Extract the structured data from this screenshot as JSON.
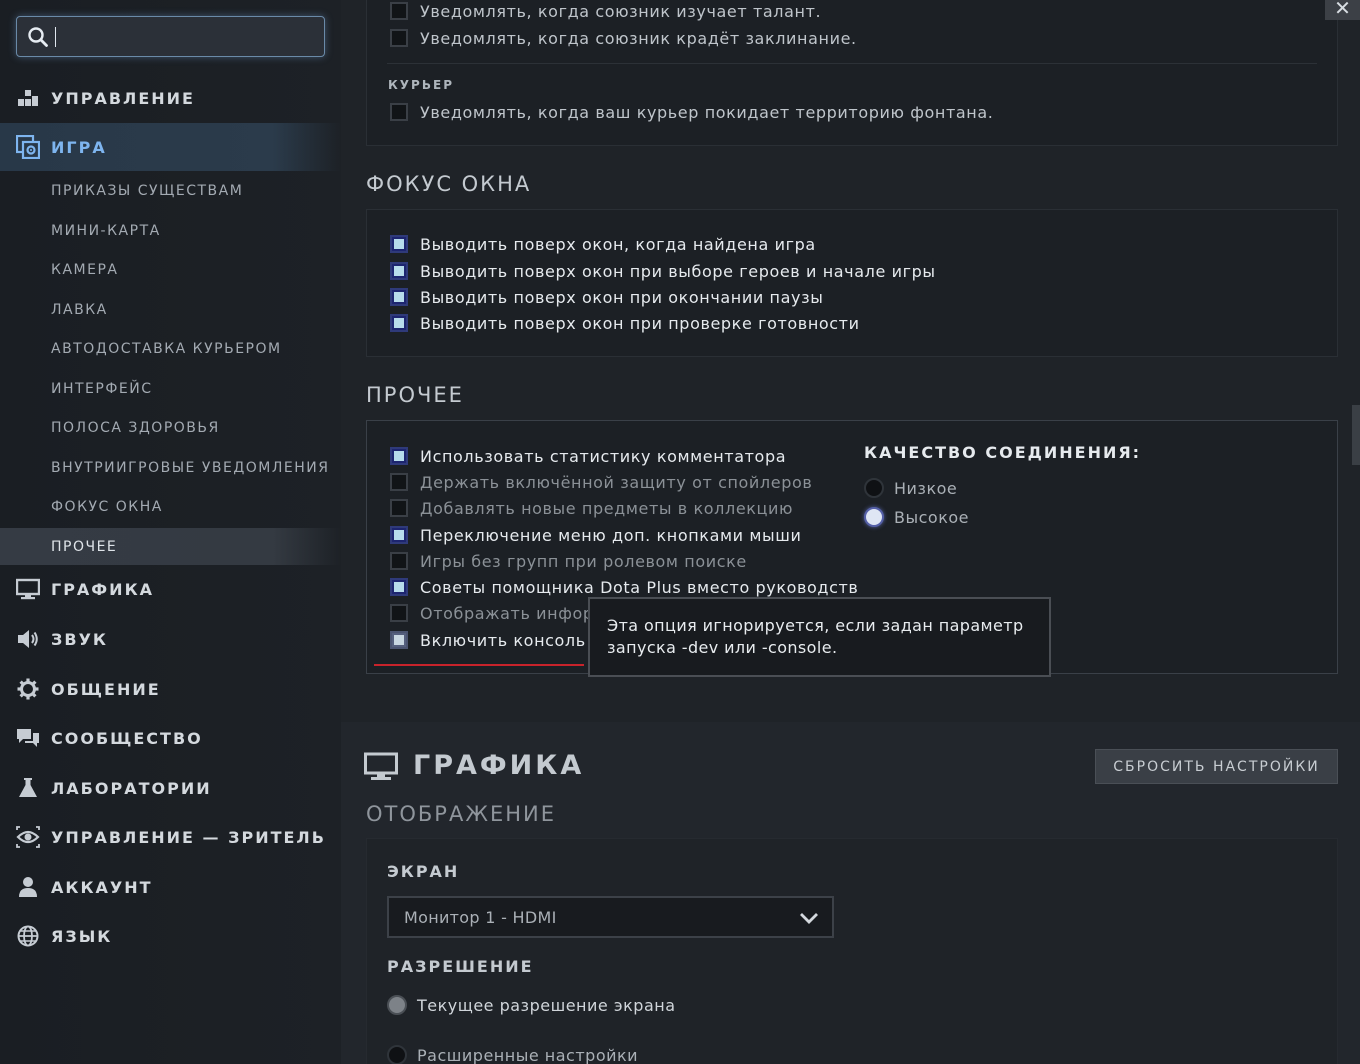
{
  "search": {
    "placeholder": ""
  },
  "sidebar": {
    "items": [
      {
        "label": "УПРАВЛЕНИЕ"
      },
      {
        "label": "ИГРА"
      },
      {
        "label": "ГРАФИКА"
      },
      {
        "label": "ЗВУК"
      },
      {
        "label": "ОБЩЕНИЕ"
      },
      {
        "label": "СООБЩЕСТВО"
      },
      {
        "label": "ЛАБОРАТОРИИ"
      },
      {
        "label": "УПРАВЛЕНИЕ — ЗРИТЕЛЬ"
      },
      {
        "label": "АККАУНТ"
      },
      {
        "label": "ЯЗЫК"
      }
    ],
    "sub_items": [
      {
        "label": "ПРИКАЗЫ СУЩЕСТВАМ"
      },
      {
        "label": "МИНИ-КАРТА"
      },
      {
        "label": "КАМЕРА"
      },
      {
        "label": "ЛАВКА"
      },
      {
        "label": "АВТОДОСТАВКА КУРЬЕРОМ"
      },
      {
        "label": "ИНТЕРФЕЙС"
      },
      {
        "label": "ПОЛОСА ЗДОРОВЬЯ"
      },
      {
        "label": "ВНУТРИИГРОВЫЕ УВЕДОМЛЕНИЯ"
      },
      {
        "label": "ФОКУС ОКНА"
      },
      {
        "label": "ПРОЧЕЕ"
      }
    ]
  },
  "notifications": {
    "items": [
      {
        "label": "Уведомлять, когда союзник изучает талант.",
        "checked": false
      },
      {
        "label": "Уведомлять, когда союзник крадёт заклинание.",
        "checked": false
      }
    ],
    "courier_heading": "КУРЬЕР",
    "courier_items": [
      {
        "label": "Уведомлять, когда ваш курьер покидает территорию фонтана.",
        "checked": false
      }
    ]
  },
  "focus": {
    "title": "ФОКУС ОКНА",
    "items": [
      {
        "label": "Выводить поверх окон, когда найдена игра",
        "checked": true
      },
      {
        "label": "Выводить поверх окон при выборе героев и начале игры",
        "checked": true
      },
      {
        "label": "Выводить поверх окон при окончании паузы",
        "checked": true
      },
      {
        "label": "Выводить поверх окон при проверке готовности",
        "checked": true
      }
    ]
  },
  "misc": {
    "title": "ПРОЧЕЕ",
    "items": [
      {
        "label": "Использовать статистику комментатора",
        "checked": true
      },
      {
        "label": "Держать включённой защиту от спойлеров",
        "checked": false
      },
      {
        "label": "Добавлять новые предметы в коллекцию",
        "checked": false
      },
      {
        "label": "Переключение меню доп. кнопками мыши",
        "checked": true
      },
      {
        "label": "Игры без групп при ролевом поиске",
        "checked": false
      },
      {
        "label": "Советы помощника Dota Plus вместо руководств",
        "checked": true
      },
      {
        "label": "Отображать информ",
        "checked": false
      },
      {
        "label": "Включить консоль",
        "checked": true
      }
    ],
    "quality_heading": "КАЧЕСТВО СОЕДИНЕНИЯ:",
    "quality_options": [
      {
        "label": "Низкое",
        "selected": false
      },
      {
        "label": "Высокое",
        "selected": true
      }
    ]
  },
  "tooltip": {
    "text": "Эта опция игнорируется, если задан параметр запуска -dev или -console."
  },
  "graphics": {
    "title": "ГРАФИКА",
    "reset_label": "СБРОСИТЬ НАСТРОЙКИ",
    "display_title": "ОТОБРАЖЕНИЕ",
    "screen_heading": "ЭКРАН",
    "screen_value": "Монитор 1 - HDMI",
    "resolution_heading": "РАЗРЕШЕНИЕ",
    "resolution_options": [
      {
        "label": "Текущее разрешение экрана",
        "selected": true
      },
      {
        "label": "Расширенные настройки",
        "selected": false
      }
    ]
  },
  "colors": {
    "accent": "#7eb5ef",
    "background": "#1f2328",
    "sidebar": "#1b1f24",
    "tooltip_underline": "#c8232b"
  },
  "window": {
    "close_label": "✕"
  }
}
